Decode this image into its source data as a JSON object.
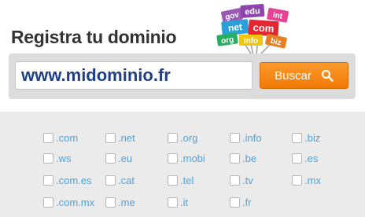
{
  "header": {
    "title": "Registra tu dominio",
    "logo_tags": [
      "gov",
      "edu",
      "int",
      "net",
      "com",
      "org",
      "info",
      "biz"
    ]
  },
  "search": {
    "value": "www.midominio.fr",
    "button_label": "Buscar"
  },
  "extensions": [
    [
      ".com",
      ".net",
      ".org",
      ".info",
      ".biz"
    ],
    [
      ".ws",
      ".eu",
      ".mobi",
      ".be",
      ".es"
    ],
    [
      ".com.es",
      ".cat",
      ".tel",
      ".tv",
      ".mx"
    ],
    [
      ".com.mx",
      ".me",
      ".it",
      ".fr"
    ]
  ],
  "colors": {
    "accent_orange": "#f5870f",
    "link_blue": "#4aa3e0",
    "input_text": "#1f3f8a",
    "panel_gray": "#ebebeb"
  },
  "icons": {
    "button_icon": "search-icon"
  }
}
